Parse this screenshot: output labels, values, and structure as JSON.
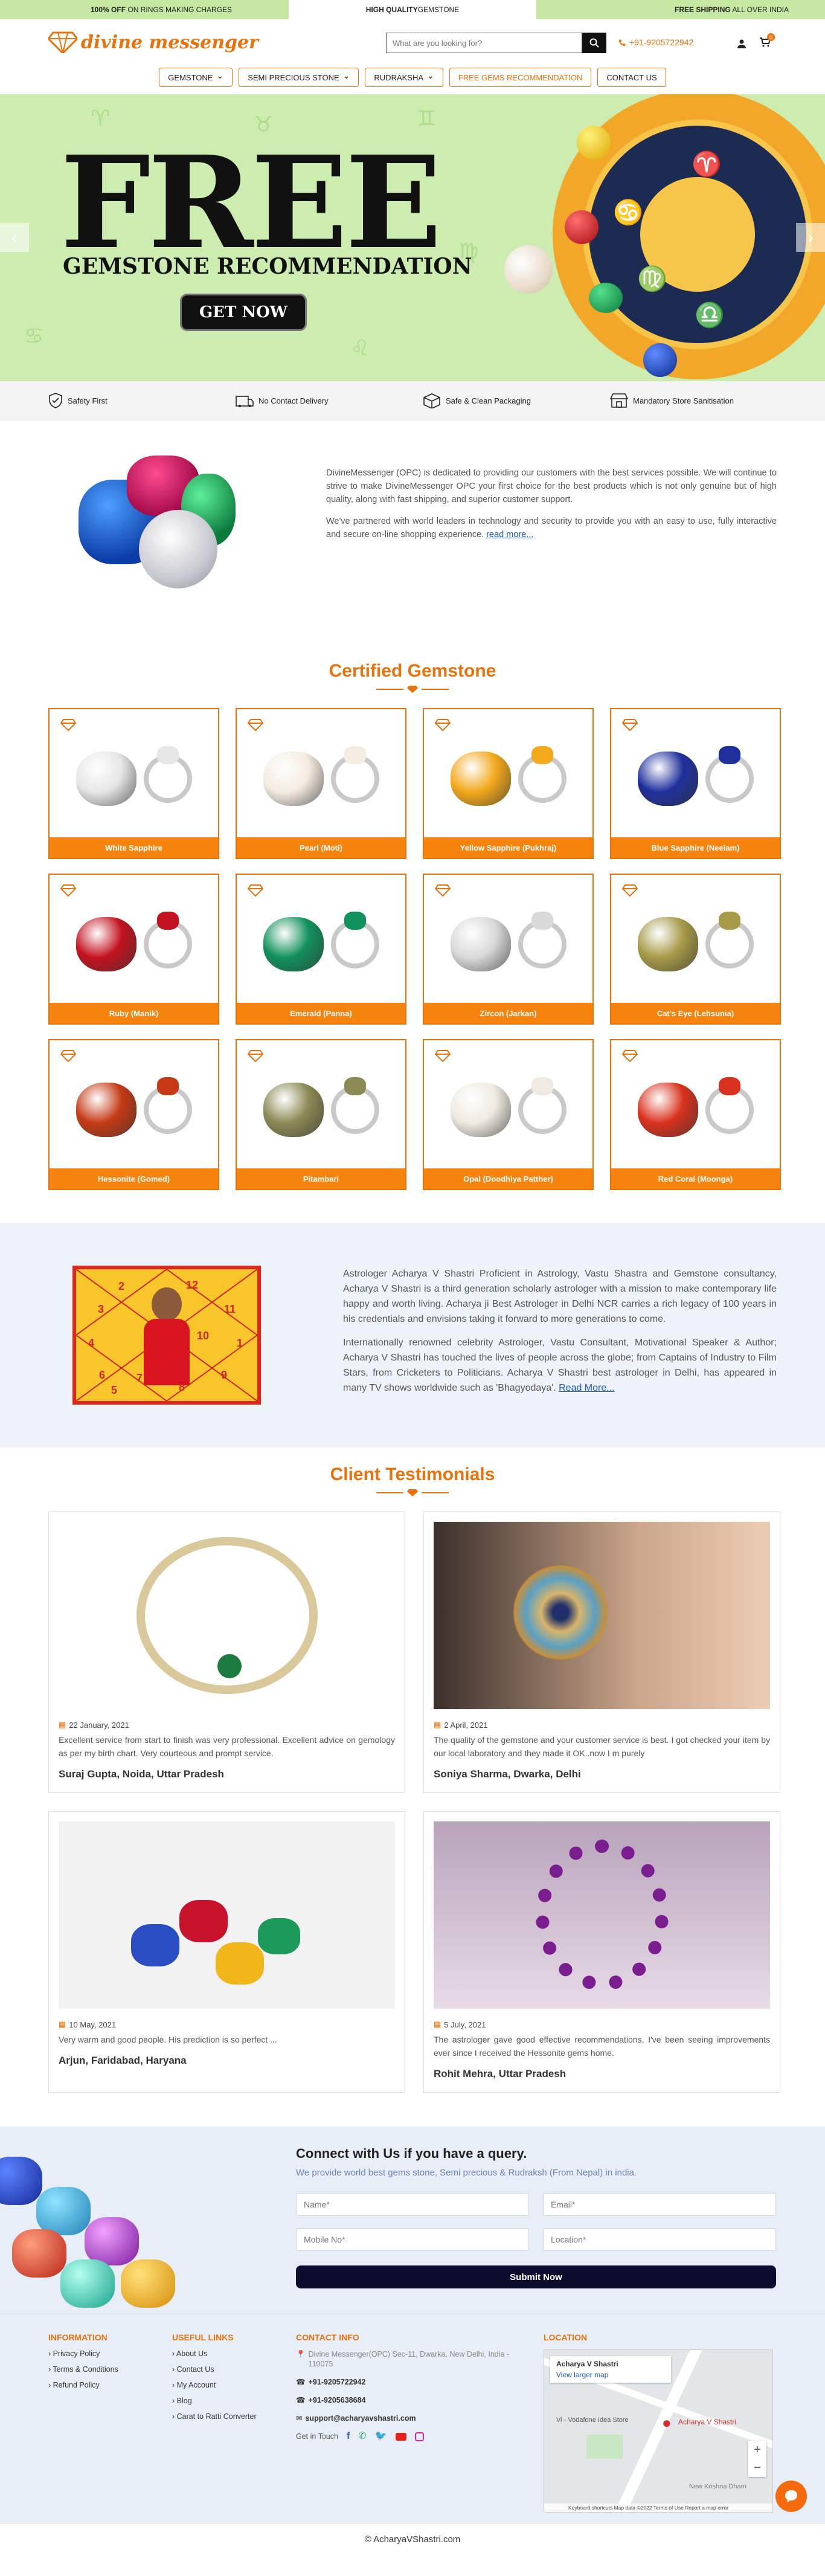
{
  "topbar": {
    "left_bold": "100% OFF",
    "left_rest": " ON RINGS MAKING CHARGES",
    "mid_bold": "HIGH QUALITY",
    "mid_rest": " GEMSTONE",
    "right_bold": "FREE SHIPPING",
    "right_rest": " ALL OVER INDIA"
  },
  "header": {
    "logo": "divine messenger",
    "search_placeholder": "What are you looking for?",
    "phone": "+91-9205722942",
    "cart_count": "0"
  },
  "nav": [
    {
      "label": "GEMSTONE",
      "dropdown": true
    },
    {
      "label": "SEMI PRECIOUS STONE",
      "dropdown": true
    },
    {
      "label": "RUDRAKSHA",
      "dropdown": true
    },
    {
      "label": "FREE GEMS RECOMMENDATION",
      "dropdown": false
    },
    {
      "label": "CONTACT US",
      "dropdown": false
    }
  ],
  "hero": {
    "headline": "FREE",
    "subline": "GEMSTONE RECOMMENDATION",
    "cta": "GET NOW"
  },
  "features": [
    "Safety First",
    "No Contact Delivery",
    "Safe & Clean Packaging",
    "Mandatory Store Sanitisation"
  ],
  "about": {
    "p1": "DivineMessenger (OPC) is dedicated to providing our customers with the best services possible. We will continue to strive to make DivineMessenger OPC your first choice for the best products which is not only genuine but of high quality, along with fast shipping, and superior customer support.",
    "p2": "We've partnered with world leaders in technology and security to provide you with an easy to use, fully interactive and secure on-line shopping experience.",
    "link": "read more..."
  },
  "certified": {
    "title": "Certified Gemstone",
    "items": [
      {
        "label": "White Sapphire",
        "color": "#e6e6e6"
      },
      {
        "label": "Pearl (Moti)",
        "color": "#f3ecdf"
      },
      {
        "label": "Yellow Sapphire (Pukhraj)",
        "color": "#f2a91b"
      },
      {
        "label": "Blue Sapphire (Neelam)",
        "color": "#1e2f9c"
      },
      {
        "label": "Ruby (Manik)",
        "color": "#c3121f"
      },
      {
        "label": "Emerald (Panna)",
        "color": "#11915b"
      },
      {
        "label": "Zircon (Jarkan)",
        "color": "#d9d9d9"
      },
      {
        "label": "Cat's Eye (Lehsunia)",
        "color": "#a79a48"
      },
      {
        "label": "Hessonite (Gomed)",
        "color": "#c53a14"
      },
      {
        "label": "Pitambari",
        "color": "#8b8a55"
      },
      {
        "label": "Opal (Doodhiya Patther)",
        "color": "#efeae0"
      },
      {
        "label": "Red Coral (Moonga)",
        "color": "#d9321e"
      }
    ]
  },
  "astro": {
    "p1": "Astrologer Acharya V Shastri Proficient in Astrology, Vastu Shastra and Gemstone consultancy, Acharya V Shastri is a third generation scholarly astrologer with a mission to make contemporary life happy and worth living. Acharya ji Best Astrologer in Delhi NCR carries a rich legacy of 100 years in his credentials and envisions taking it forward to more generations to come.",
    "p2": "Internationally renowned celebrity Astrologer, Vastu Consultant, Motivational Speaker & Author; Acharya V Shastri has touched the lives of people across the globe; from Captains of Industry to Film Stars, from Cricketers to Politicians. Acharya V Shastri best astrologer in Delhi, has appeared in many TV shows worldwide such as 'Bhagyodaya'.",
    "link": "Read More...",
    "chart_numbers": [
      "12",
      "3",
      "2",
      "11",
      "10",
      "4",
      "1",
      "7",
      "8",
      "9",
      "6",
      "5"
    ]
  },
  "testimonials": {
    "title": "Client Testimonials",
    "items": [
      {
        "date": "22 January, 2021",
        "text": "Excellent service from start to finish was very professional. Excellent advice on gemology as per my birth chart. Very courteous and prompt service.",
        "name": "Suraj Gupta, Noida, Uttar Pradesh"
      },
      {
        "date": "2 April, 2021",
        "text": "The quality of the gemstone and your customer service is best. I got checked your item by our local laboratory and they made it OK..now I m purely",
        "name": "Soniya Sharma, Dwarka, Delhi"
      },
      {
        "date": "10 May, 2021",
        "text": "Very warm and good people. His prediction is so perfect ...",
        "name": "Arjun, Faridabad, Haryana"
      },
      {
        "date": "5 July, 2021",
        "text": "The astrologer gave good effective recommendations, I've been seeing improvements ever since I received the Hessonite gems home.",
        "name": "Rohit Mehra, Uttar Pradesh"
      }
    ]
  },
  "contact": {
    "title": "Connect with Us if you have a query.",
    "subtitle": "We provide world best gems stone, Semi precious & Rudraksh (From Nepal) in india.",
    "name_ph": "Name*",
    "email_ph": "Email*",
    "mobile_ph": "Mobile No*",
    "location_ph": "Location*",
    "submit": "Submit Now"
  },
  "footer": {
    "info_title": "INFORMATION",
    "info": [
      "Privacy Policy",
      "Terms & Conditions",
      "Refund Policy"
    ],
    "links_title": "USEFUL LINKS",
    "links": [
      "About Us",
      "Contact Us",
      "My Account",
      "Blog",
      "Carat to Ratti Converter"
    ],
    "contact_title": "CONTACT INFO",
    "address": "Divine Messenger(OPC) Sec-11, Dwarka, New Delhi, India - 110075",
    "phone1": "+91-9205722942",
    "phone2": "+91-9205638684",
    "email": "support@acharyavshastri.com",
    "touch": "Get in Touch",
    "location_title": "LOCATION",
    "map_name": "Acharya V Shastri",
    "map_link": "View larger map",
    "map_pin": "Acharya V Shastri",
    "map_store": "Vi - Vodafone Idea Store",
    "map_area": "New Krishna Dham",
    "map_foot": "Keyboard shortcuts   Map data ©2022   Terms of Use   Report a map error",
    "copyright": "© AcharyaVShastri.com"
  }
}
